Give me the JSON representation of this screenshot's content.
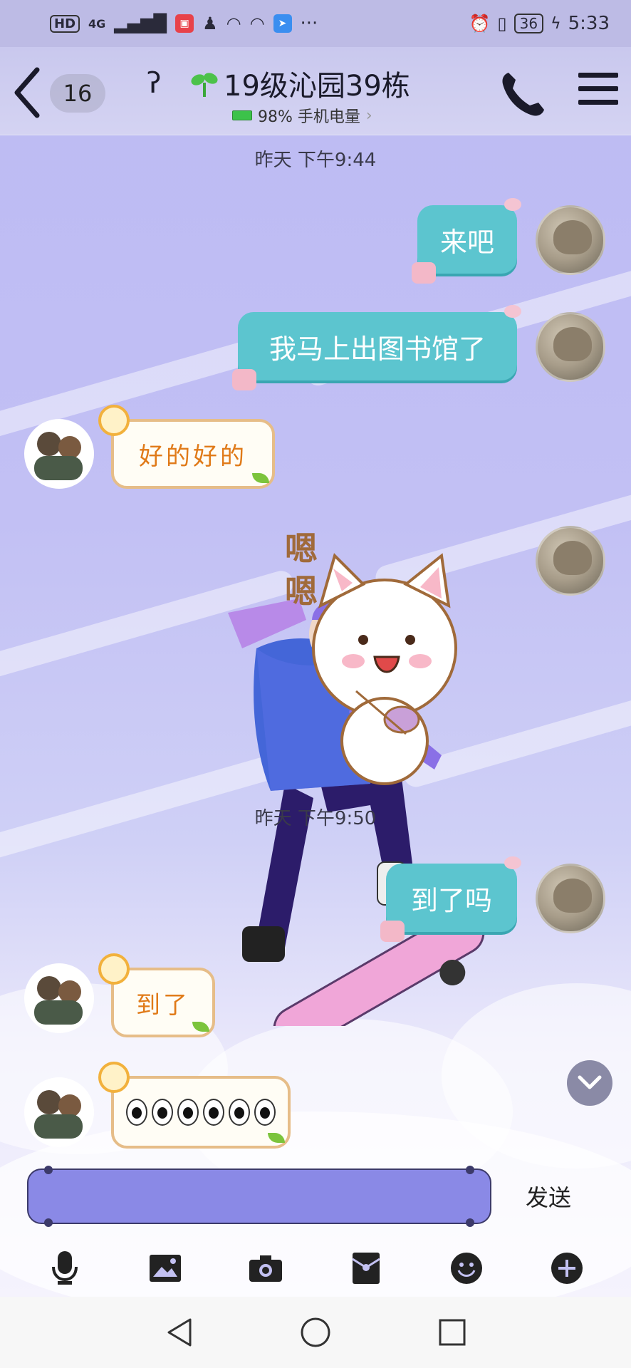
{
  "status_bar": {
    "hd": "HD",
    "network": "4G",
    "more": "···",
    "battery": "36",
    "time": "5:33"
  },
  "header": {
    "unread_count": "16",
    "title": "19级沁园39栋",
    "subtitle": "98% 手机电量"
  },
  "messages": {
    "timestamp_1": "昨天 下午9:44",
    "m1": "来吧",
    "m2": "我马上出图书馆了",
    "m3": "好的好的",
    "sticker_text": "嗯嗯",
    "timestamp_2": "昨天 下午9:50",
    "m4": "到了吗",
    "m5": "到了"
  },
  "input": {
    "send_label": "发送"
  },
  "colors": {
    "my_bubble": "#5cc5cf",
    "their_bubble_border": "#e6bd88",
    "their_text": "#e07a18",
    "input_bg": "#8a89e6"
  }
}
